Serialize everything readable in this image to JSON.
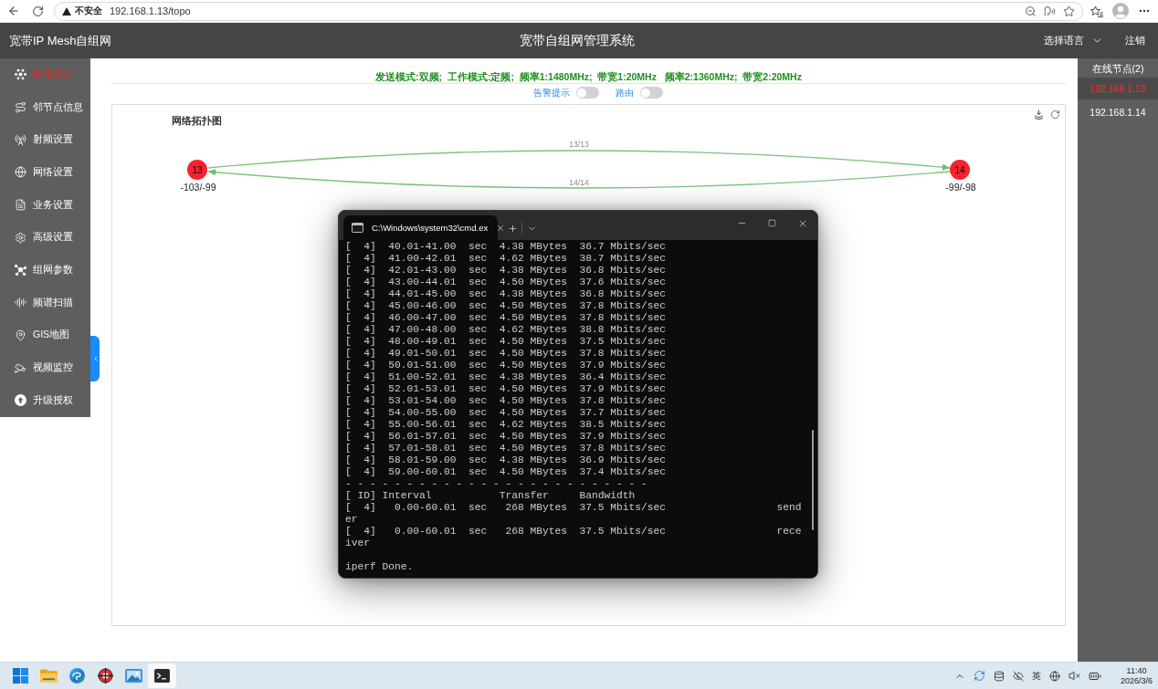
{
  "browser": {
    "security_label": "不安全",
    "url": "192.168.1.13/topo"
  },
  "header": {
    "brand": "宽带IP Mesh自组网",
    "title": "宽带自组网管理系统",
    "language": "选择语言",
    "logout": "注销"
  },
  "sidebar": {
    "items": [
      {
        "label": "网络拓扑",
        "selected": true
      },
      {
        "label": "邻节点信息",
        "selected": false
      },
      {
        "label": "射频设置",
        "selected": false
      },
      {
        "label": "网络设置",
        "selected": false
      },
      {
        "label": "业务设置",
        "selected": false
      },
      {
        "label": "高级设置",
        "selected": false
      },
      {
        "label": "组网参数",
        "selected": false
      },
      {
        "label": "频谱扫描",
        "selected": false
      },
      {
        "label": "GIS地图",
        "selected": false
      },
      {
        "label": "视频监控",
        "selected": false
      },
      {
        "label": "升级授权",
        "selected": false
      }
    ]
  },
  "mode_summary": "发送模式:双频;  工作模式:定频;  频率1:1480MHz;  带宽1:20MHz   频率2:1360MHz;  带宽2:20MHz",
  "toggles": [
    {
      "label": "告警提示",
      "on": false
    },
    {
      "label": "路由",
      "on": false
    }
  ],
  "topology": {
    "title": "网络拓扑图",
    "nodes": [
      {
        "label": "13",
        "signal": "-103/-99"
      },
      {
        "label": "14",
        "signal": "-99/-98"
      }
    ],
    "links": [
      {
        "label": "13/13",
        "reversed": false
      },
      {
        "label": "14/14",
        "reversed": true
      }
    ]
  },
  "online_nodes": {
    "title": "在线节点(2)",
    "items": [
      {
        "label": "192.168.1.13",
        "selected": true
      },
      {
        "label": "192.168.1.14",
        "selected": false
      }
    ]
  },
  "terminal": {
    "tab_title": "C:\\Windows\\system32\\cmd.ex",
    "lines": [
      "[  4]  40.01-41.00  sec  4.38 MBytes  36.7 Mbits/sec",
      "[  4]  41.00-42.01  sec  4.62 MBytes  38.7 Mbits/sec",
      "[  4]  42.01-43.00  sec  4.38 MBytes  36.8 Mbits/sec",
      "[  4]  43.00-44.01  sec  4.50 MBytes  37.6 Mbits/sec",
      "[  4]  44.01-45.00  sec  4.38 MBytes  36.8 Mbits/sec",
      "[  4]  45.00-46.00  sec  4.50 MBytes  37.8 Mbits/sec",
      "[  4]  46.00-47.00  sec  4.50 MBytes  37.8 Mbits/sec",
      "[  4]  47.00-48.00  sec  4.62 MBytes  38.8 Mbits/sec",
      "[  4]  48.00-49.01  sec  4.50 MBytes  37.5 Mbits/sec",
      "[  4]  49.01-50.01  sec  4.50 MBytes  37.8 Mbits/sec",
      "[  4]  50.01-51.00  sec  4.50 MBytes  37.9 Mbits/sec",
      "[  4]  51.00-52.01  sec  4.38 MBytes  36.4 Mbits/sec",
      "[  4]  52.01-53.01  sec  4.50 MBytes  37.9 Mbits/sec",
      "[  4]  53.01-54.00  sec  4.50 MBytes  37.8 Mbits/sec",
      "[  4]  54.00-55.00  sec  4.50 MBytes  37.7 Mbits/sec",
      "[  4]  55.00-56.01  sec  4.62 MBytes  38.5 Mbits/sec",
      "[  4]  56.01-57.01  sec  4.50 MBytes  37.9 Mbits/sec",
      "[  4]  57.01-58.01  sec  4.50 MBytes  37.8 Mbits/sec",
      "[  4]  58.01-59.00  sec  4.38 MBytes  36.9 Mbits/sec",
      "[  4]  59.00-60.01  sec  4.50 MBytes  37.4 Mbits/sec",
      "- - - - - - - - - - - - - - - - - - - - - - - - -",
      "[ ID] Interval           Transfer     Bandwidth",
      "[  4]   0.00-60.01  sec   268 MBytes  37.5 Mbits/sec                  send",
      "er",
      "[  4]   0.00-60.01  sec   268 MBytes  37.5 Mbits/sec                  rece",
      "iver"
    ],
    "last_line": "iperf Done."
  },
  "taskbar": {
    "apps": [
      {
        "kind": "start",
        "active": false
      },
      {
        "kind": "folder",
        "active": false
      },
      {
        "kind": "swirl",
        "active": false
      },
      {
        "kind": "crosshair",
        "active": false
      },
      {
        "kind": "picture",
        "active": false
      },
      {
        "kind": "terminal",
        "active": true
      }
    ],
    "input_method": "英",
    "time": "11:40",
    "date": "2026/3/6"
  }
}
